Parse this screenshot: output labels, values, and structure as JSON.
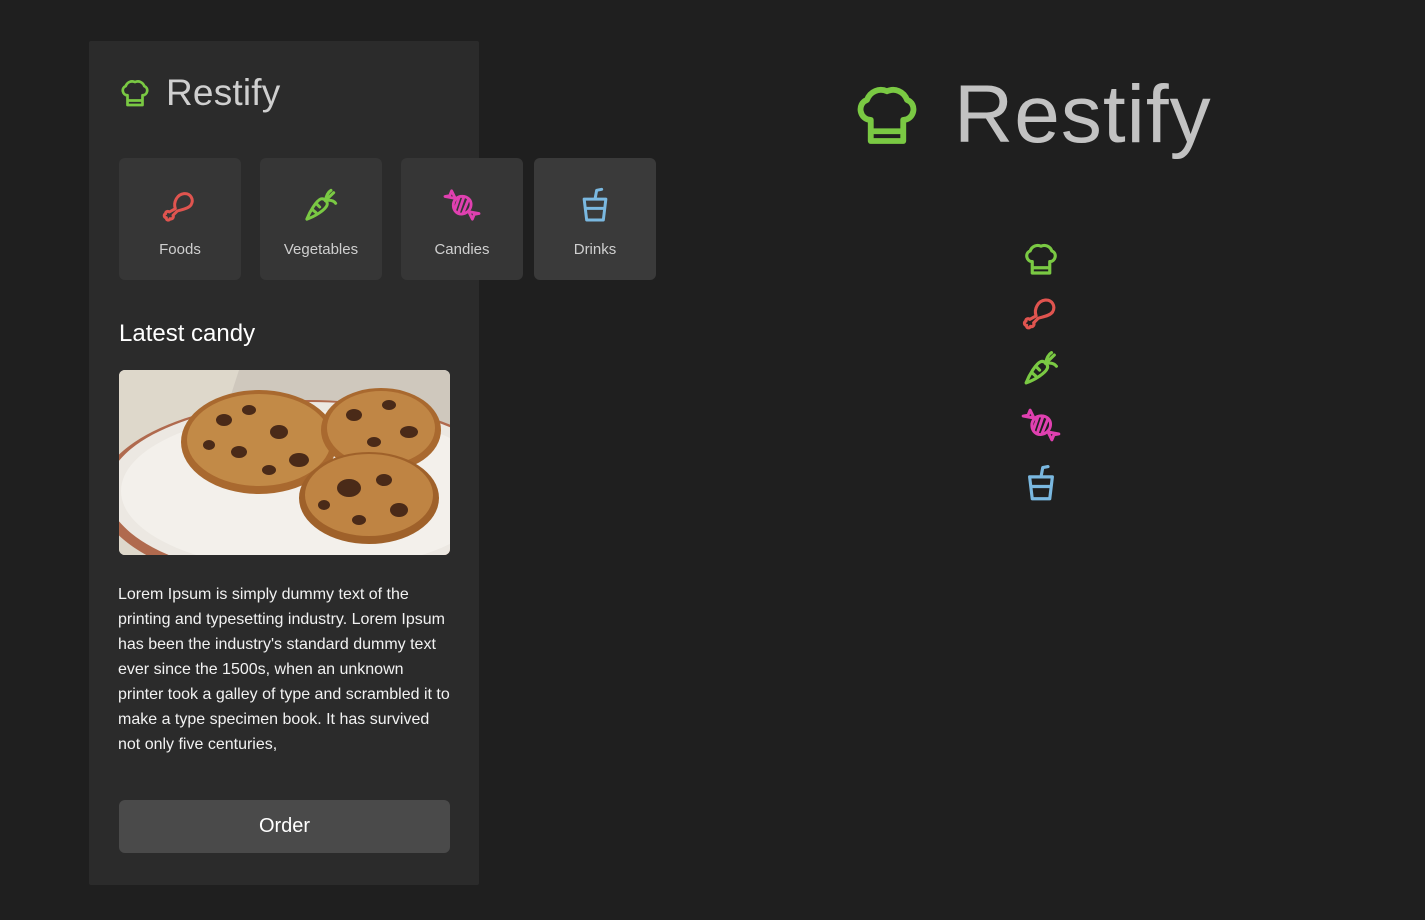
{
  "app": {
    "name": "Restify",
    "icon": "chef-hat-icon"
  },
  "colors": {
    "background": "#1f1f1f",
    "panel": "#2b2b2b",
    "card": "#363636",
    "chef_hat": "#7ac943",
    "foods": "#e0544f",
    "vegetables": "#7ac943",
    "candies": "#e040b0",
    "drinks": "#7ab8e0",
    "button": "#4a4a4a"
  },
  "categories": [
    {
      "label": "Foods",
      "icon": "drumstick-icon"
    },
    {
      "label": "Vegetables",
      "icon": "carrot-icon"
    },
    {
      "label": "Candies",
      "icon": "candy-icon"
    },
    {
      "label": "Drinks",
      "icon": "cup-icon"
    }
  ],
  "latest": {
    "title": "Latest candy",
    "image": "chocolate-chip-cookies-image",
    "description": "Lorem Ipsum is simply dummy text of the printing and typesetting industry. Lorem Ipsum has been the industry's standard dummy text ever since the 1500s, when an unknown printer took a galley of type and scrambled it to make a type specimen book. It has survived not only five centuries,",
    "button_label": "Order"
  },
  "showcase": {
    "logo_text": "Restify",
    "icons": [
      "chef-hat-icon",
      "drumstick-icon",
      "carrot-icon",
      "candy-icon",
      "cup-icon"
    ]
  }
}
